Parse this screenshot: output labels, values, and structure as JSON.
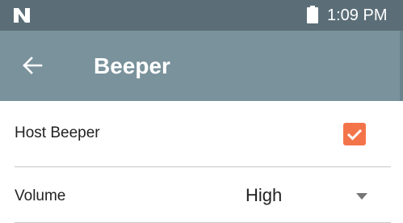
{
  "status_bar": {
    "time": "1:09 PM",
    "notification_icon": "n-logo-icon",
    "battery_icon": "battery-icon"
  },
  "app_bar": {
    "title": "Beeper",
    "back_icon": "arrow-left-icon"
  },
  "settings": {
    "host_beeper": {
      "label": "Host Beeper",
      "checked": true,
      "accent_color": "#f4744a"
    },
    "volume": {
      "label": "Volume",
      "selected_value": "High"
    }
  },
  "colors": {
    "status_bar": "#5b6e78",
    "app_bar": "#7a929c"
  }
}
